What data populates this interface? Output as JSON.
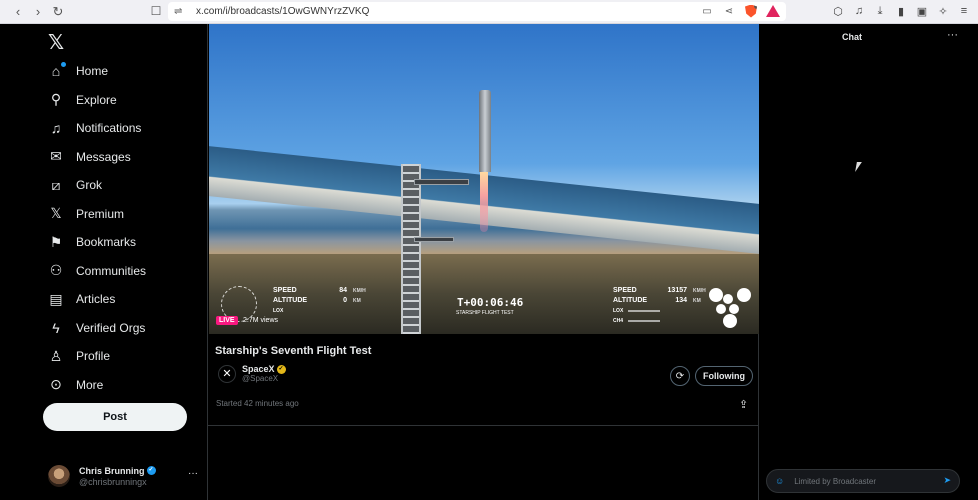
{
  "browser": {
    "url": "x.com/i/broadcasts/1OwGWNYrzZVKQ",
    "back_icon": "chevron-left-icon",
    "forward_icon": "chevron-right-icon",
    "reload_icon": "reload-icon"
  },
  "sidebar": {
    "logo": "𝕏",
    "items": [
      {
        "label": "Home",
        "icon": "home-icon",
        "glyph": "⌂"
      },
      {
        "label": "Explore",
        "icon": "search-icon",
        "glyph": "⚲"
      },
      {
        "label": "Notifications",
        "icon": "bell-icon",
        "glyph": "♫"
      },
      {
        "label": "Messages",
        "icon": "envelope-icon",
        "glyph": "✉"
      },
      {
        "label": "Grok",
        "icon": "grok-icon",
        "glyph": "⧄"
      },
      {
        "label": "Premium",
        "icon": "x-premium-icon",
        "glyph": "𝕏"
      },
      {
        "label": "Bookmarks",
        "icon": "bookmark-icon",
        "glyph": "⚑"
      },
      {
        "label": "Communities",
        "icon": "people-icon",
        "glyph": "⚇"
      },
      {
        "label": "Articles",
        "icon": "article-icon",
        "glyph": "▤"
      },
      {
        "label": "Verified Orgs",
        "icon": "lightning-icon",
        "glyph": "ϟ"
      },
      {
        "label": "Profile",
        "icon": "person-icon",
        "glyph": "♙"
      },
      {
        "label": "More",
        "icon": "more-circle-icon",
        "glyph": "⊙"
      }
    ],
    "post_label": "Post",
    "account": {
      "name": "Chris Brunning",
      "handle": "@chrisbrunningx",
      "more": "···"
    }
  },
  "broadcast": {
    "title": "Starship's Seventh Flight Test",
    "live_badge": "LIVE",
    "views": "2.7M views",
    "author_name": "SpaceX",
    "author_handle": "@SpaceX",
    "follow_label": "Following",
    "started": "Started 42 minutes ago",
    "hud": {
      "left": {
        "speed_label": "SPEED",
        "speed": "84",
        "altitude_label": "ALTITUDE",
        "altitude": "0",
        "speed_unit": "KM/H",
        "alt_unit": "KM",
        "lox": "LOX",
        "ch4": "CH4"
      },
      "right": {
        "speed_label": "SPEED",
        "speed": "13157",
        "altitude_label": "ALTITUDE",
        "altitude": "134",
        "speed_unit": "KM/H",
        "alt_unit": "KM",
        "lox": "LOX",
        "ch4": "CH4"
      },
      "timer": "T+00:06:46",
      "timer_sub": "STARSHIP FLIGHT TEST"
    }
  },
  "chat": {
    "title": "Chat",
    "more": "···",
    "placeholder": "Limited by Broadcaster"
  }
}
